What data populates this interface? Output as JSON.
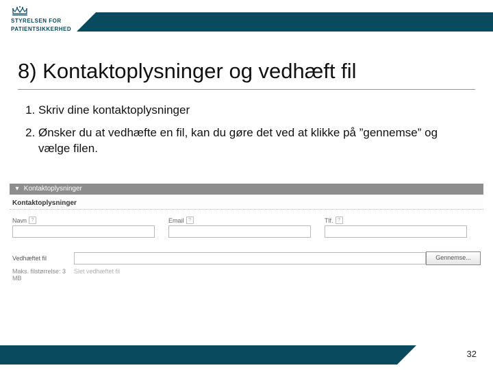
{
  "header": {
    "logo_line1": "STYRELSEN FOR",
    "logo_line2": "PATIENTSIKKERHED"
  },
  "title": "8) Kontaktoplysninger og vedhæft fil",
  "instructions": {
    "item1": "Skriv dine kontaktoplysninger",
    "item2": "Ønsker du at vedhæfte en fil, kan du gøre det ved at klikke på ”gennemse” og vælge filen."
  },
  "form": {
    "section_title": "Kontaktoplysninger",
    "sub_header": "Kontaktoplysninger",
    "expander_glyph": "▾",
    "fields": {
      "name": {
        "label": "Navn",
        "help": "?"
      },
      "email": {
        "label": "Email",
        "help": "?"
      },
      "phone": {
        "label": "Tlf.",
        "help": "?"
      }
    },
    "attach": {
      "label": "Vedhæftet fil",
      "browse_button": "Gennemse...",
      "max_size": "Maks. filstørrelse: 3 MB",
      "delete_link": "Slet vedhæftet fil"
    }
  },
  "footer": {
    "page_number": "32"
  }
}
